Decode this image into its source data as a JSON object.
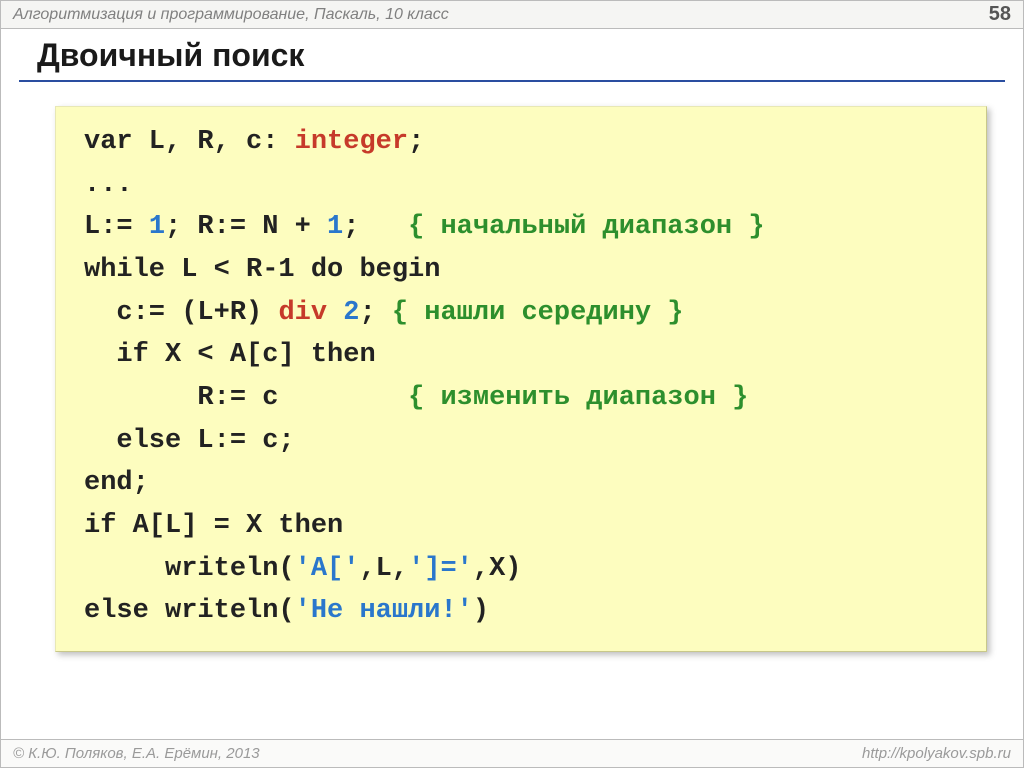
{
  "header": {
    "breadcrumb": "Алгоритмизация и программирование, Паскаль, 10 класс",
    "page_number": "58"
  },
  "title": "Двоичный поиск",
  "code": {
    "l1_a": "var L, R, c: ",
    "l1_b": "integer",
    "l1_c": ";",
    "l2": "...",
    "l3_a": "L:= ",
    "l3_b": "1",
    "l3_c": "; R:= N + ",
    "l3_d": "1",
    "l3_e": ";   ",
    "l3_f": "{ начальный диапазон }",
    "l4": "while L < R-1 do begin",
    "l5_a": "  c:= (L+R) ",
    "l5_b": "div",
    "l5_c": " ",
    "l5_d": "2",
    "l5_e": "; ",
    "l5_f": "{ нашли середину }",
    "l6": "  if X < A[c] then",
    "l7_a": "       R:= c        ",
    "l7_b": "{ изменить диапазон }",
    "l8": "  else L:= c;",
    "l9": "end;",
    "l10": "if A[L] = X then",
    "l11_a": "     writeln(",
    "l11_b": "'A['",
    "l11_c": ",L,",
    "l11_d": "']='",
    "l11_e": ",X)",
    "l12_a": "else writeln(",
    "l12_b": "'Не нашли!'",
    "l12_c": ")"
  },
  "footer": {
    "copyright": "© К.Ю. Поляков, Е.А. Ерёмин, 2013",
    "url": "http://kpolyakov.spb.ru"
  }
}
